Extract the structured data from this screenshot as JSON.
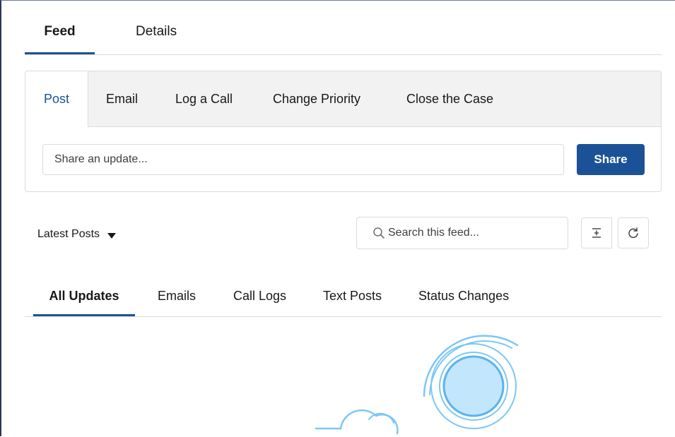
{
  "top_tabs": [
    {
      "label": "Feed",
      "active": true
    },
    {
      "label": "Details",
      "active": false
    }
  ],
  "publisher": {
    "tabs": [
      {
        "label": "Post",
        "active": true
      },
      {
        "label": "Email",
        "active": false
      },
      {
        "label": "Log a Call",
        "active": false
      },
      {
        "label": "Change Priority",
        "active": false
      },
      {
        "label": "Close the Case",
        "active": false
      }
    ],
    "input_placeholder": "Share an update...",
    "share_label": "Share"
  },
  "feed_controls": {
    "sort_label": "Latest Posts",
    "search_placeholder": "Search this feed..."
  },
  "filter_tabs": [
    {
      "label": "All Updates",
      "active": true
    },
    {
      "label": "Emails",
      "active": false
    },
    {
      "label": "Call Logs",
      "active": false
    },
    {
      "label": "Text Posts",
      "active": false
    },
    {
      "label": "Status Changes",
      "active": false
    }
  ],
  "icons": {
    "search": "search-icon",
    "sort_caret": "caret-down-icon",
    "collapse": "collapse-all-icon",
    "refresh": "refresh-icon"
  },
  "colors": {
    "brand": "#1b5297",
    "border": "#dddbda",
    "tab_bar_bg": "#f3f2f2",
    "illustration": "#7cc7f5",
    "illustration_fill": "#c2e6fb"
  }
}
